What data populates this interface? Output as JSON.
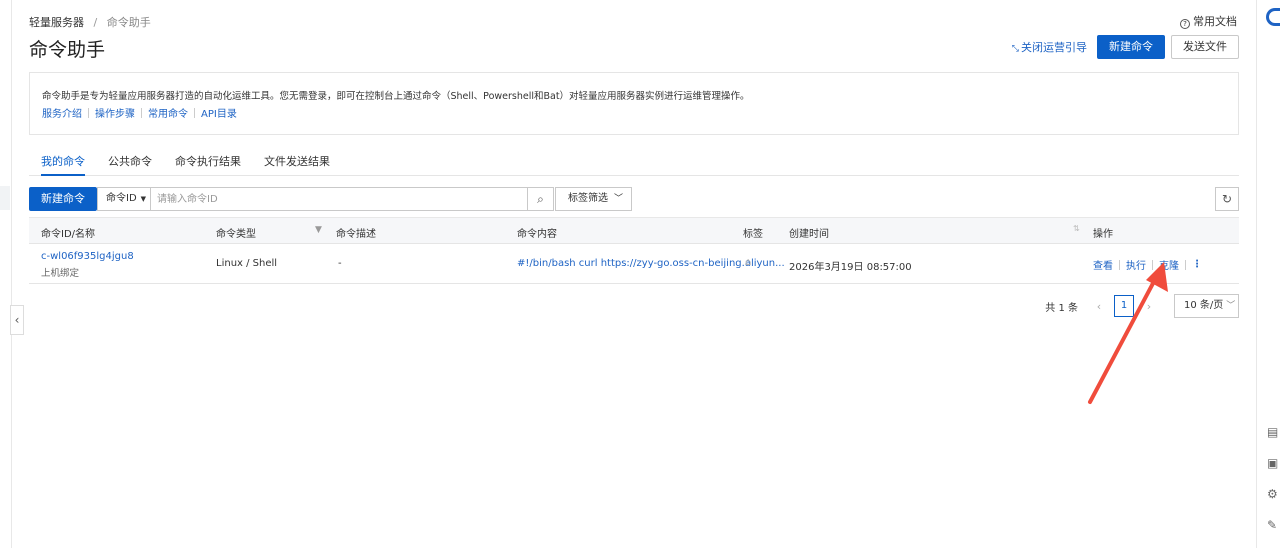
{
  "breadcrumb": {
    "parent": "轻量服务器",
    "separator": "/",
    "current": "命令助手"
  },
  "help": {
    "icon": "question-circle-icon",
    "label": "常用文档"
  },
  "page": {
    "title": "命令助手"
  },
  "header_actions": {
    "guide_icon": "collapse-arrows-icon",
    "guide_label": "关闭运营引导",
    "create_label": "新建命令",
    "send_file_label": "发送文件"
  },
  "info": {
    "description": "命令助手是专为轻量应用服务器打造的自动化运维工具。您无需登录，即可在控制台上通过命令（Shell、Powershell和Bat）对轻量应用服务器实例进行运维管理操作。",
    "links": [
      "服务介绍",
      "操作步骤",
      "常用命令",
      "API目录"
    ]
  },
  "tabs": [
    {
      "label": "我的命令",
      "active": true
    },
    {
      "label": "公共命令",
      "active": false
    },
    {
      "label": "命令执行结果",
      "active": false
    },
    {
      "label": "文件发送结果",
      "active": false
    }
  ],
  "toolbar": {
    "create_label": "新建命令",
    "search_field": "命令ID",
    "search_placeholder": "请输入命令ID",
    "tag_filter_label": "标签筛选"
  },
  "table": {
    "columns": {
      "id_name": "命令ID/名称",
      "type": "命令类型",
      "description": "命令描述",
      "content": "命令内容",
      "tags": "标签",
      "created": "创建时间",
      "actions": "操作"
    },
    "rows": [
      {
        "id": "c-wl06f935lg4jgu8",
        "name": "上机绑定",
        "type": "Linux / Shell",
        "description": "-",
        "content": "#!/bin/bash curl https://zyy-go.oss-cn-beijing.aliyun...",
        "created": "2026年3月19日 08:57:00",
        "actions": {
          "view": "查看",
          "run": "执行",
          "clone": "克隆",
          "more_icon": "more-vertical-icon"
        }
      }
    ]
  },
  "pagination": {
    "total_label": "共 1 条",
    "current_page": "1",
    "page_size_label": "10 条/页"
  },
  "colors": {
    "primary": "#0b60c8",
    "link": "#1e63c4",
    "annotation_arrow": "#f04c3c"
  }
}
